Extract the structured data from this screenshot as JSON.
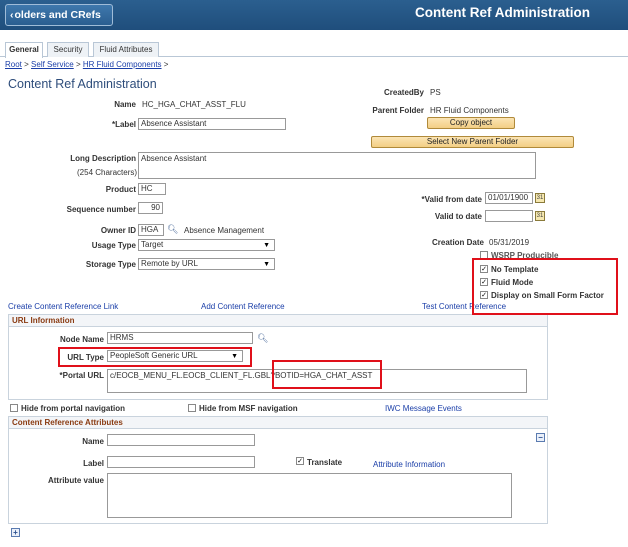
{
  "header": {
    "back_label": "olders and CRefs",
    "title": "Content Ref Administration"
  },
  "tabs": [
    {
      "label": "General",
      "active": true
    },
    {
      "label": "Security",
      "active": false
    },
    {
      "label": "Fluid Attributes",
      "active": false
    }
  ],
  "breadcrumb": {
    "root": "Root",
    "sep1": " > ",
    "self_service": "Self Service",
    "sep2": " > ",
    "hr_fluid": "HR Fluid Components",
    "sep3": " >"
  },
  "page_title": "Content Ref Administration",
  "form": {
    "name_label": "Name",
    "name_value": "HC_HGA_CHAT_ASST_FLU",
    "label_label": "*Label",
    "label_value": "Absence Assistant",
    "created_by_label": "CreatedBy",
    "created_by_value": "PS",
    "parent_folder_label": "Parent Folder",
    "parent_folder_value": "HR Fluid Components",
    "copy_object_button": "Copy object",
    "select_parent_button": "Select New Parent Folder",
    "long_desc_label": "Long Description",
    "long_desc_chars": "(254 Characters)",
    "long_desc_value": "Absence Assistant",
    "product_label": "Product",
    "product_value": "HC",
    "valid_from_label": "*Valid from date",
    "valid_from_value": "01/01/1900",
    "sequence_label": "Sequence number",
    "sequence_value": "90",
    "valid_to_label": "Valid to date",
    "valid_to_value": "",
    "owner_id_label": "Owner ID",
    "owner_id_value": "HGA",
    "owner_id_desc": "Absence Management",
    "usage_type_label": "Usage Type",
    "usage_type_value": "Target",
    "creation_date_label": "Creation Date",
    "creation_date_value": "05/31/2019",
    "storage_type_label": "Storage Type",
    "storage_type_value": "Remote by URL",
    "wsrp_label": "WSRP Producible",
    "no_template_label": "No Template",
    "fluid_mode_label": "Fluid Mode",
    "small_form_label": "Display on Small Form Factor"
  },
  "links": {
    "create_link": "Create Content Reference Link",
    "add_content_ref": "Add Content Reference",
    "test_content_ref": "Test Content Reference"
  },
  "url_info": {
    "section_title": "URL Information",
    "node_name_label": "Node Name",
    "node_name_value": "HRMS",
    "url_type_label": "URL Type",
    "url_type_value": "PeopleSoft Generic URL",
    "portal_url_label": "*Portal URL",
    "portal_url_value": "c/EOCB_MENU_FL.EOCB_CLIENT_FL.GBL?BOTID=HGA_CHAT_ASST"
  },
  "hide_options": {
    "hide_portal_nav": "Hide from portal navigation",
    "hide_msf_nav": "Hide from MSF navigation",
    "iwc_events": "IWC Message Events"
  },
  "cref_attrs": {
    "section_title": "Content Reference Attributes",
    "name_label": "Name",
    "label_label": "Label",
    "translate_label": "Translate",
    "attr_info_link": "Attribute Information",
    "attr_value_label": "Attribute value"
  },
  "colors": {
    "banner": "#1f4e7c",
    "highlight": "#e0101a",
    "section_title": "#8a3b12",
    "link": "#1a3ea8"
  }
}
